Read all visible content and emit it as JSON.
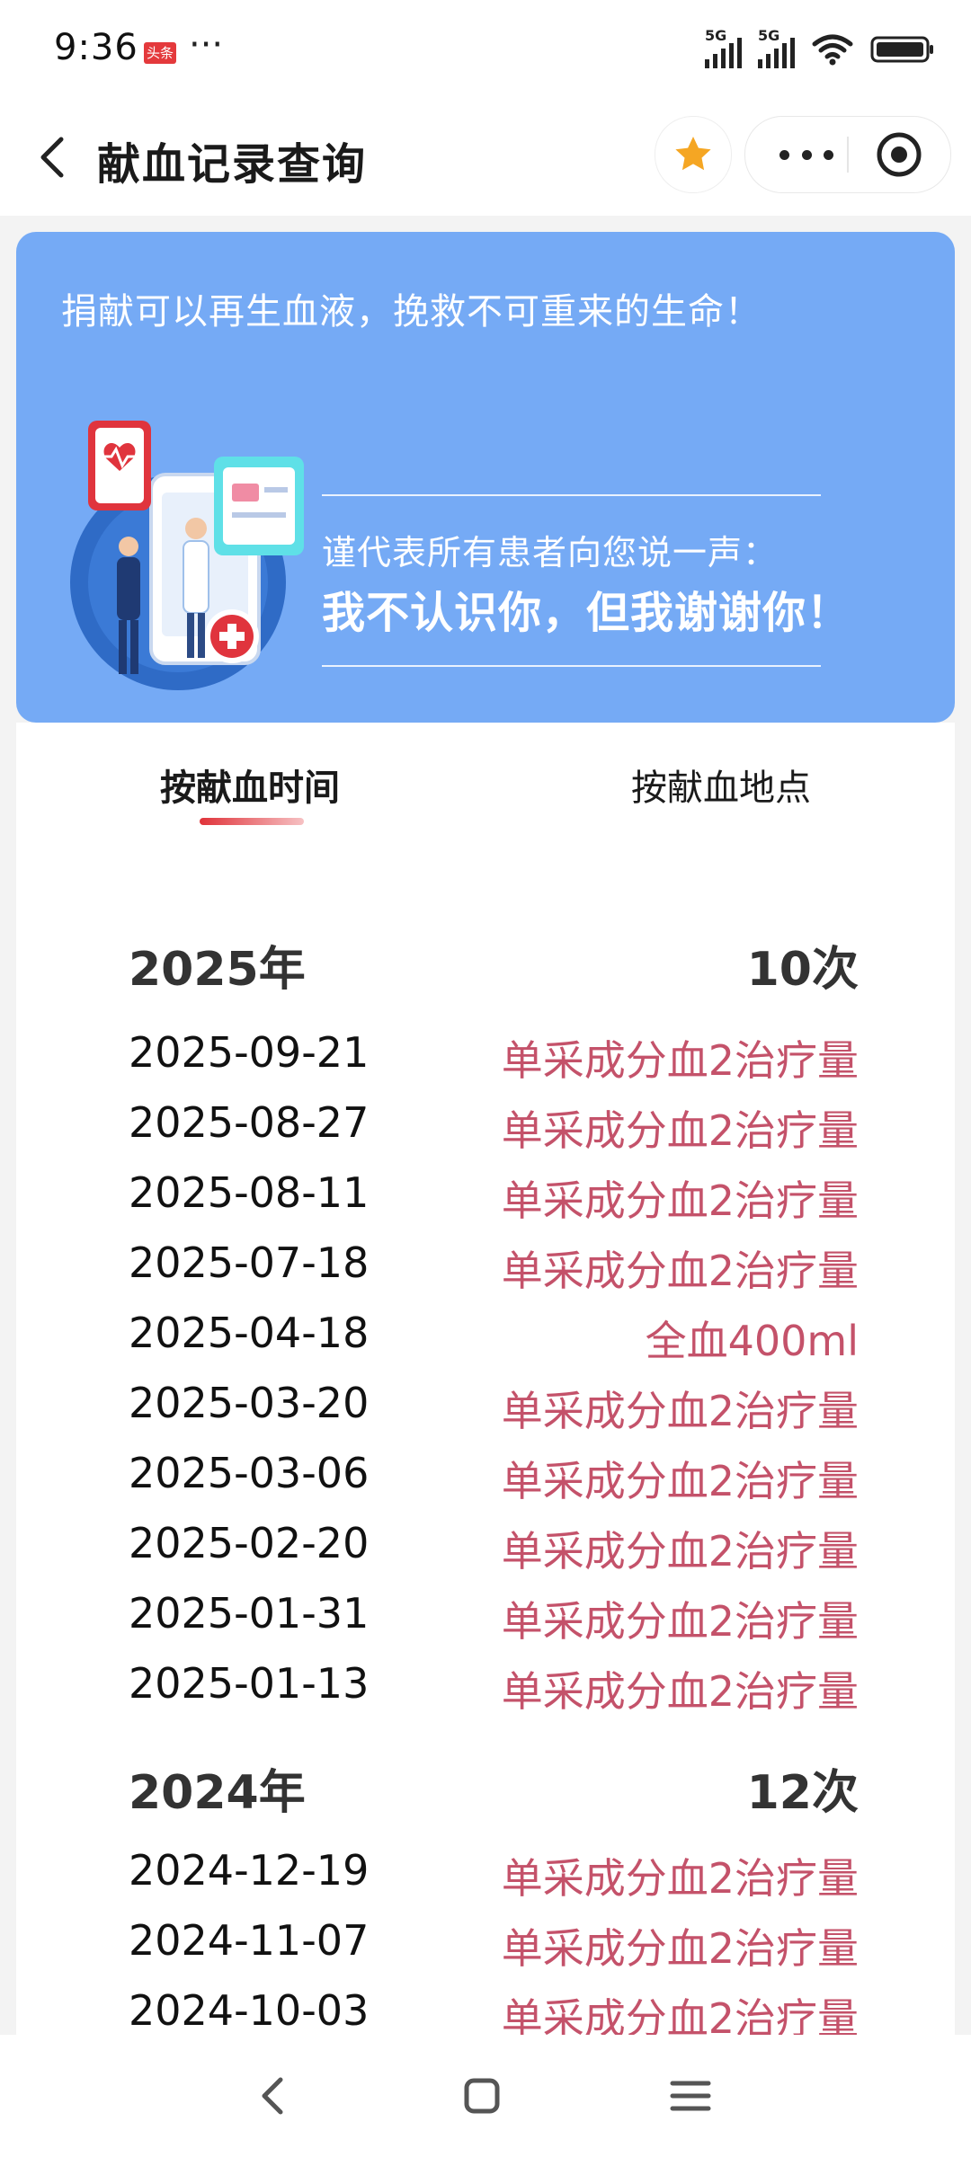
{
  "status_bar": {
    "time": "9:36",
    "badge": "头条",
    "dots": "···",
    "network1": "5G",
    "network2": "5G"
  },
  "header": {
    "title": "献血记录查询"
  },
  "banner": {
    "slogan": "捐献可以再生血液，挽救不可重来的生命！",
    "subtitle": "谨代表所有患者向您说一声：",
    "thanks": "我不认识你，但我谢谢你！"
  },
  "tabs": [
    {
      "label": "按献血时间"
    },
    {
      "label": "按献血地点"
    }
  ],
  "years": [
    {
      "year": "2025年",
      "count": "10次",
      "records": [
        {
          "date": "2025-09-21",
          "type": "单采成分血2治疗量"
        },
        {
          "date": "2025-08-27",
          "type": "单采成分血2治疗量"
        },
        {
          "date": "2025-08-11",
          "type": "单采成分血2治疗量"
        },
        {
          "date": "2025-07-18",
          "type": "单采成分血2治疗量"
        },
        {
          "date": "2025-04-18",
          "type": "全血400ml"
        },
        {
          "date": "2025-03-20",
          "type": "单采成分血2治疗量"
        },
        {
          "date": "2025-03-06",
          "type": "单采成分血2治疗量"
        },
        {
          "date": "2025-02-20",
          "type": "单采成分血2治疗量"
        },
        {
          "date": "2025-01-31",
          "type": "单采成分血2治疗量"
        },
        {
          "date": "2025-01-13",
          "type": "单采成分血2治疗量"
        }
      ]
    },
    {
      "year": "2024年",
      "count": "12次",
      "records": [
        {
          "date": "2024-12-19",
          "type": "单采成分血2治疗量"
        },
        {
          "date": "2024-11-07",
          "type": "单采成分血2治疗量"
        },
        {
          "date": "2024-10-03",
          "type": "单采成分血2治疗量"
        }
      ]
    }
  ],
  "colors": {
    "banner_bg": "#75aaf5",
    "record_type": "#c4526a",
    "tab_indicator": "#e0333a",
    "favorite_star": "#f5a623"
  }
}
